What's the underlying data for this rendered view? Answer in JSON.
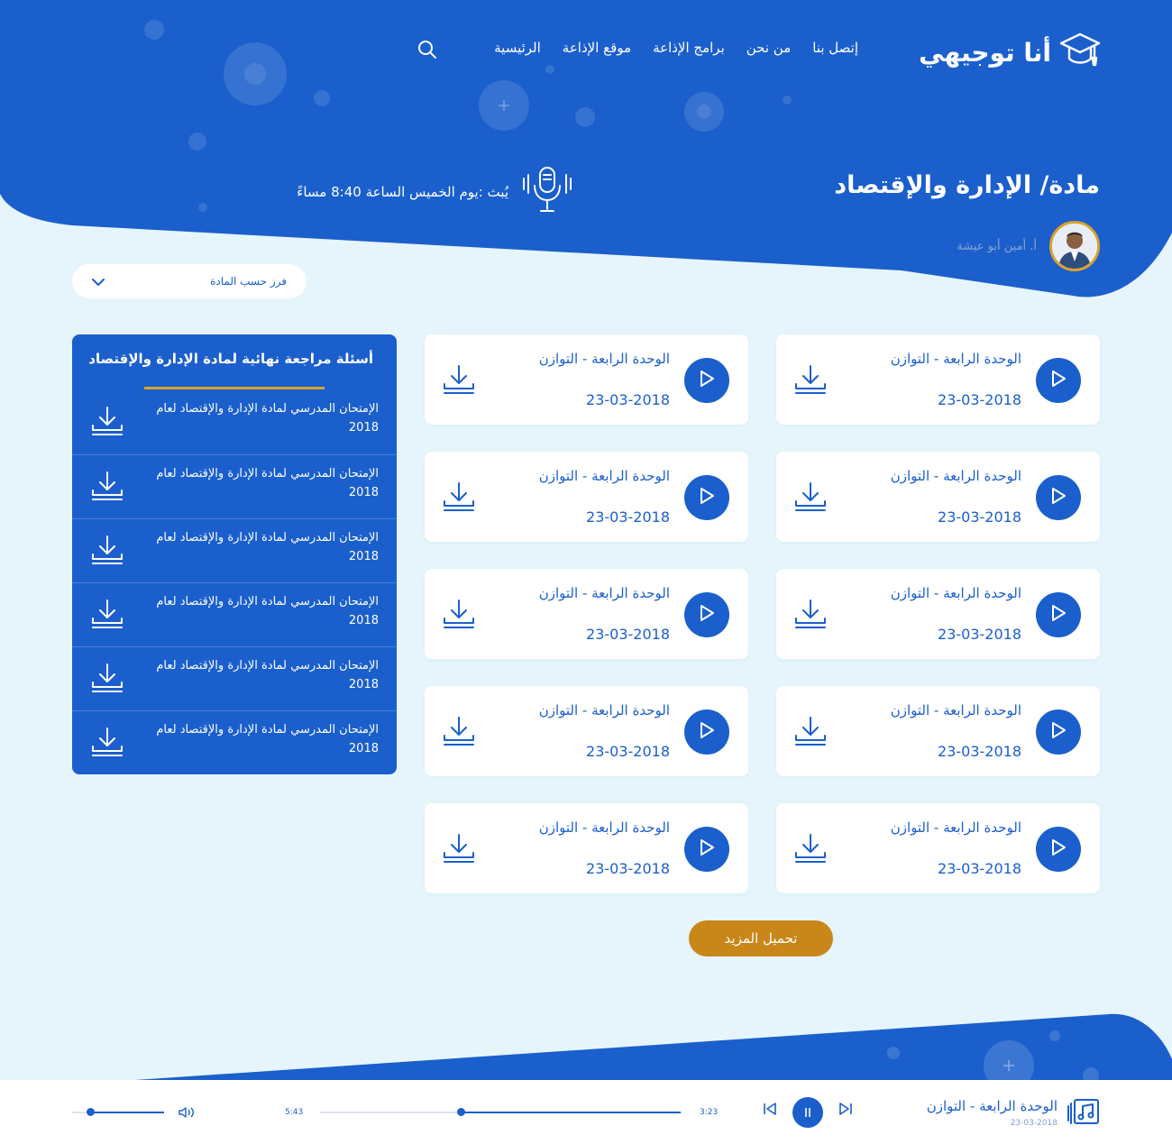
{
  "brand": {
    "logo_text": "أنا توجيهي"
  },
  "nav": {
    "items": [
      "الرئيسية",
      "موقع الإذاعة",
      "برامج الإذاعة",
      "من نحن",
      "إتصل بنا"
    ]
  },
  "hero": {
    "title": "مادة/ الإدارة والإقتصاد",
    "broadcast": "يُبث :يوم الخميس الساعة 8:40 مساءً",
    "teacher_name": "أ. أمين أبو عيشة"
  },
  "filter": {
    "label": "فرز حسب المادة"
  },
  "episodes": [
    {
      "title": "الوحدة الرابعة - التوازن",
      "date": "23-03-2018"
    },
    {
      "title": "الوحدة الرابعة - التوازن",
      "date": "23-03-2018"
    },
    {
      "title": "الوحدة الرابعة - التوازن",
      "date": "23-03-2018"
    },
    {
      "title": "الوحدة الرابعة - التوازن",
      "date": "23-03-2018"
    },
    {
      "title": "الوحدة الرابعة - التوازن",
      "date": "23-03-2018"
    },
    {
      "title": "الوحدة الرابعة - التوازن",
      "date": "23-03-2018"
    },
    {
      "title": "الوحدة الرابعة - التوازن",
      "date": "23-03-2018"
    },
    {
      "title": "الوحدة الرابعة - التوازن",
      "date": "23-03-2018"
    },
    {
      "title": "الوحدة الرابعة - التوازن",
      "date": "23-03-2018"
    },
    {
      "title": "الوحدة الرابعة - التوازن",
      "date": "23-03-2018"
    }
  ],
  "load_more": "تحميل المزيد",
  "review": {
    "title": "أسئلة مراجعة نهائية لمادة الإدارة والإقتصاد",
    "items": [
      "الإمتحان المدرسي لمادة الإدارة والإقتصاد لعام 2018",
      "الإمتحان المدرسي لمادة الإدارة والإقتصاد لعام 2018",
      "الإمتحان المدرسي لمادة الإدارة والإقتصاد لعام 2018",
      "الإمتحان المدرسي لمادة الإدارة والإقتصاد لعام 2018",
      "الإمتحان المدرسي لمادة الإدارة والإقتصاد لعام 2018",
      "الإمتحان المدرسي لمادة الإدارة والإقتصاد لعام 2018"
    ]
  },
  "player": {
    "track_title": "الوحدة الرابعة - التوازن",
    "track_date": "23-03-2018",
    "current_time": "3:23",
    "duration": "5:43",
    "progress": 0.61,
    "volume": 0.8
  },
  "colors": {
    "primary": "#1a5fcc",
    "accent": "#c9871a",
    "background": "#e5f5fb"
  },
  "icons": [
    "graduation-cap-icon",
    "search-icon",
    "microphone-icon",
    "play-icon",
    "download-icon",
    "chevron-down-icon",
    "music-note-icon",
    "skip-previous-icon",
    "pause-icon",
    "skip-next-icon",
    "volume-icon"
  ]
}
